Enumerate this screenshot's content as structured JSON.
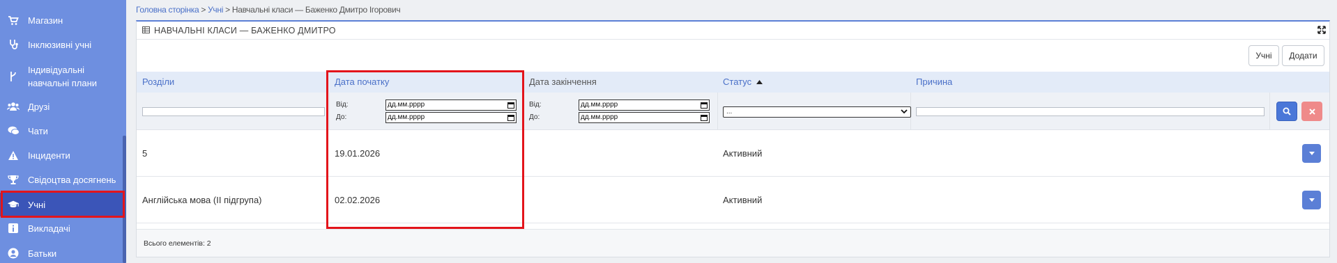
{
  "sidebar": {
    "items": [
      {
        "label": "Магазин",
        "icon": "cart-icon"
      },
      {
        "label": "Інклюзивні учні",
        "icon": "stethoscope-icon"
      },
      {
        "label": "Індивідуальні навчальні плани",
        "icon": "branch-icon"
      },
      {
        "label": "Друзі",
        "icon": "users-icon"
      },
      {
        "label": "Чати",
        "icon": "chat-icon"
      },
      {
        "label": "Інциденти",
        "icon": "warning-icon"
      },
      {
        "label": "Свідоцтва досягнень",
        "icon": "trophy-icon"
      },
      {
        "label": "Учні",
        "icon": "graduation-cap-icon",
        "active": true
      },
      {
        "label": "Викладачі",
        "icon": "info-icon"
      },
      {
        "label": "Батьки",
        "icon": "user-circle-icon"
      }
    ]
  },
  "breadcrumb": {
    "home": "Головна сторінка",
    "sep1": " > ",
    "students": "Учні",
    "sep2": " > ",
    "current": "Навчальні класи — Баженко Дмитро Ігорович"
  },
  "panel": {
    "title": "НАВЧАЛЬНІ КЛАСИ — БАЖЕНКО ДМИТРО",
    "buttons": {
      "students": "Учні",
      "add": "Додати"
    }
  },
  "table": {
    "columns": {
      "sections": "Розділи",
      "start_date": "Дата початку",
      "end_date": "Дата закінчення",
      "status": "Статус",
      "reason": "Причина"
    },
    "filters": {
      "from_label": "Від:",
      "to_label": "До:",
      "date_placeholder": "дд.мм.рррр",
      "status_select": "..."
    },
    "rows": [
      {
        "section": "5",
        "start_date": "19.01.2026",
        "end_date": "",
        "status": "Активний",
        "reason": ""
      },
      {
        "section": "Англійська мова (II підгрупа)",
        "start_date": "02.02.2026",
        "end_date": "",
        "status": "Активний",
        "reason": ""
      }
    ]
  },
  "footer": {
    "total": "Всього елементів: 2"
  },
  "colors": {
    "sidebar": "#6e8fe0",
    "active": "#3b55b8",
    "accent": "#4a70c8",
    "highlight": "#e3141b"
  }
}
